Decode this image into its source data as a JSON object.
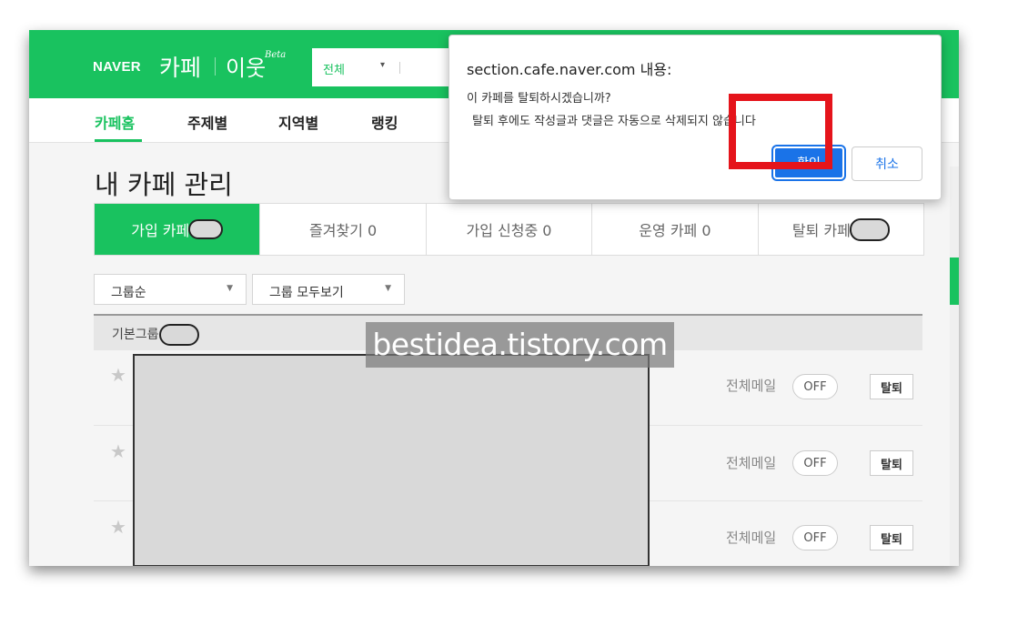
{
  "header": {
    "logo_naver": "NAVER",
    "logo_cafe": "카페",
    "logo_neighbor": "이웃",
    "logo_beta": "Beta",
    "search_scope": "전체",
    "brand_color": "#19c25f"
  },
  "nav": {
    "items": [
      "카페홈",
      "주제별",
      "지역별",
      "랭킹"
    ],
    "active_index": 0
  },
  "page_title": "내 카페 관리",
  "tabs": {
    "joined": "가입 카페",
    "favorites": "즐겨찾기 0",
    "pending": "가입 신청중 0",
    "managed": "운영 카페 0",
    "withdrawn": "탈퇴 카페"
  },
  "filters": {
    "sort": "그룹순",
    "view": "그룹 모두보기"
  },
  "group": {
    "label": "기본그룹"
  },
  "rows": [
    {
      "mail_label": "전체메일",
      "mail_status": "OFF",
      "leave_label": "탈퇴"
    },
    {
      "mail_label": "전체메일",
      "mail_status": "OFF",
      "leave_label": "탈퇴"
    },
    {
      "mail_label": "전체메일",
      "mail_status": "OFF",
      "leave_label": "탈퇴"
    }
  ],
  "watermark": "bestidea.tistory.com",
  "dialog": {
    "title": "section.cafe.naver.com 내용:",
    "line1": "이 카페를 탈퇴하시겠습니까?",
    "line2": "탈퇴 후에도 작성글과 댓글은 자동으로 삭제되지 않습니다",
    "ok_label": "확인",
    "cancel_label": "취소",
    "highlight_color": "#e5141b"
  }
}
